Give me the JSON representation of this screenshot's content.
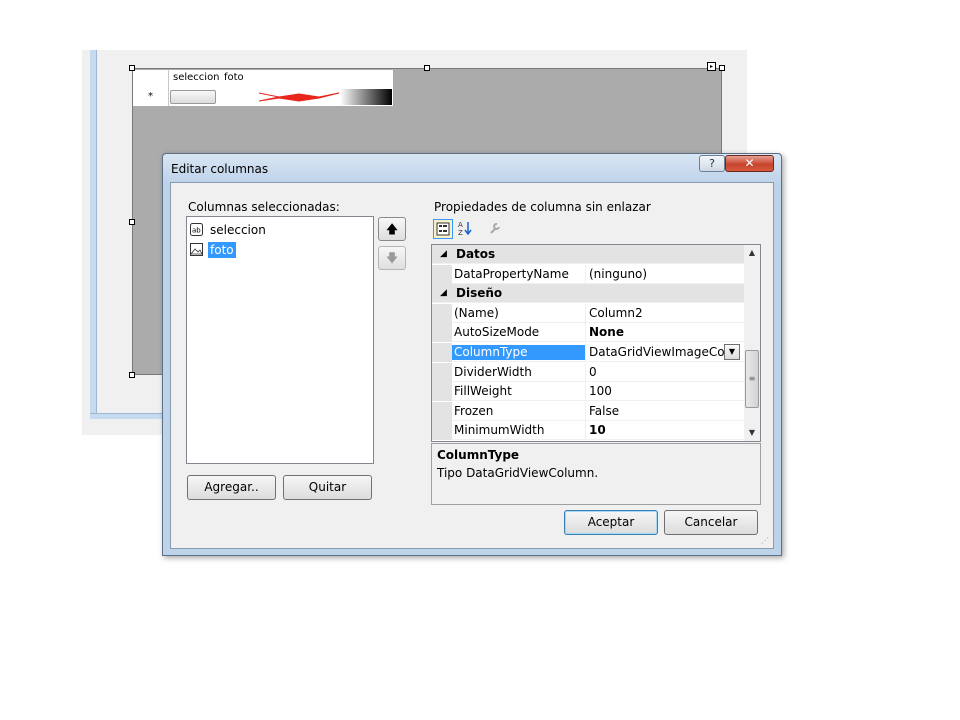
{
  "designer": {
    "grid": {
      "columns": [
        "seleccion",
        "foto"
      ],
      "new_row_marker": "*"
    },
    "smart_tag_glyph": "▸"
  },
  "dialog": {
    "title": "Editar columnas",
    "help_label": "?",
    "close_label": "✕",
    "selected_columns_label": "Columnas seleccionadas:",
    "columns": [
      {
        "label": "seleccion",
        "icon": "textbox-column-icon",
        "selected": false
      },
      {
        "label": "foto",
        "icon": "image-column-icon",
        "selected": true
      }
    ],
    "move_up_label": "🡅",
    "move_down_label": "🡇",
    "add_button": "Agregar..",
    "remove_button": "Quitar",
    "properties_label": "Propiedades de columna sin enlazar",
    "property_grid": {
      "rows": [
        {
          "type": "category",
          "name": "Datos",
          "expander": "◢"
        },
        {
          "type": "prop",
          "name": "DataPropertyName",
          "value": "(ninguno)"
        },
        {
          "type": "category",
          "name": "Diseño",
          "expander": "◢"
        },
        {
          "type": "prop",
          "name": "(Name)",
          "value": "Column2"
        },
        {
          "type": "prop",
          "name": "AutoSizeMode",
          "value": "None",
          "bold": true
        },
        {
          "type": "prop",
          "name": "ColumnType",
          "value": "DataGridViewImageColu",
          "selected": true,
          "dropdown": "▼"
        },
        {
          "type": "prop",
          "name": "DividerWidth",
          "value": "0"
        },
        {
          "type": "prop",
          "name": "FillWeight",
          "value": "100"
        },
        {
          "type": "prop",
          "name": "Frozen",
          "value": "False"
        },
        {
          "type": "prop",
          "name": "MinimumWidth",
          "value": "10",
          "bold": true
        }
      ],
      "scroll": {
        "up": "▲",
        "down": "▼",
        "thumb": "≡"
      }
    },
    "description": {
      "title": "ColumnType",
      "text": "Tipo DataGridViewColumn."
    },
    "ok_button": "Aceptar",
    "cancel_button": "Cancelar",
    "resize_grip": "⋰"
  },
  "colors": {
    "selection": "#3399ff",
    "grid_background": "#ababab",
    "close_button": "#c7442d",
    "image_placeholder": "#e8261b"
  }
}
